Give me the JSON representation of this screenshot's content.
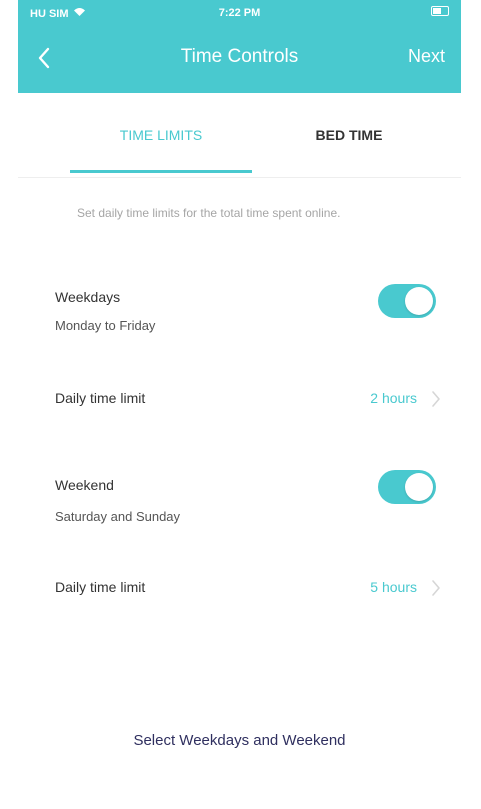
{
  "status_bar": {
    "carrier": "HU SIM",
    "time": "7:22 PM",
    "battery_icon": "battery-icon",
    "wifi_icon": "wifi-icon"
  },
  "nav": {
    "title": "Time Controls",
    "next_label": "Next",
    "back_icon": "chevron-left-icon"
  },
  "tabs": [
    {
      "label": "TIME LIMITS",
      "active": true
    },
    {
      "label": "BED TIME",
      "active": false
    }
  ],
  "description": "Set daily time limits for the total time spent online.",
  "weekdays": {
    "title": "Weekdays",
    "subtitle": "Monday to Friday",
    "enabled": true,
    "limit_label": "Daily time limit",
    "limit_value": "2 hours"
  },
  "weekend": {
    "title": "Weekend",
    "subtitle": "Saturday and Sunday",
    "enabled": true,
    "limit_label": "Daily time limit",
    "limit_value": "5 hours"
  },
  "bottom_action": "Select Weekdays and Weekend",
  "colors": {
    "accent": "#49c9cf",
    "text": "#333333",
    "muted": "#a5a5a5",
    "action": "#2f2f5f"
  }
}
